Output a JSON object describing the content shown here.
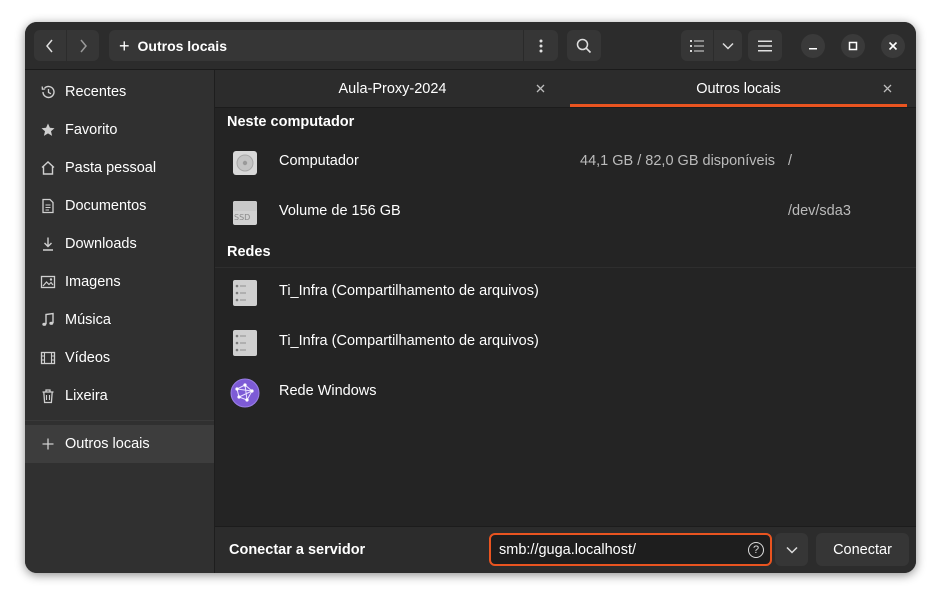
{
  "header": {
    "path_label": "Outros locais",
    "back_icon": "chevron-left-icon",
    "forward_icon": "chevron-right-icon"
  },
  "sidebar": {
    "items": [
      {
        "label": "Recentes",
        "icon": "clock-icon"
      },
      {
        "label": "Favorito",
        "icon": "star-icon"
      },
      {
        "label": "Pasta pessoal",
        "icon": "home-icon"
      },
      {
        "label": "Documentos",
        "icon": "document-icon"
      },
      {
        "label": "Downloads",
        "icon": "download-icon"
      },
      {
        "label": "Imagens",
        "icon": "image-icon"
      },
      {
        "label": "Música",
        "icon": "music-icon"
      },
      {
        "label": "Vídeos",
        "icon": "video-icon"
      },
      {
        "label": "Lixeira",
        "icon": "trash-icon"
      },
      {
        "label": "Outros locais",
        "icon": "plus-icon"
      }
    ]
  },
  "tabs": [
    {
      "label": "Aula-Proxy-2024",
      "active": false
    },
    {
      "label": "Outros locais",
      "active": true
    }
  ],
  "content": {
    "computer_section": "Neste computador",
    "computer_items": [
      {
        "label": "Computador",
        "info": "44,1 GB / 82,0 GB disponíveis",
        "mount": "/"
      },
      {
        "label": "Volume de 156 GB",
        "info": "",
        "mount": "/dev/sda3",
        "badge": "SSD"
      }
    ],
    "network_section": "Redes",
    "network_items": [
      {
        "label": "Ti_Infra (Compartilhamento de arquivos)"
      },
      {
        "label": "Ti_Infra (Compartilhamento de arquivos)"
      },
      {
        "label": "Rede Windows"
      }
    ]
  },
  "bottom": {
    "connect_label": "Conectar a servidor",
    "server_address": "smb://guga.localhost/",
    "help": "?",
    "connect_button": "Conectar"
  },
  "colors": {
    "accent": "#e95420",
    "window_bg": "#242424",
    "sidebar_bg": "#303030",
    "network_icon": "#7d5bd6"
  }
}
